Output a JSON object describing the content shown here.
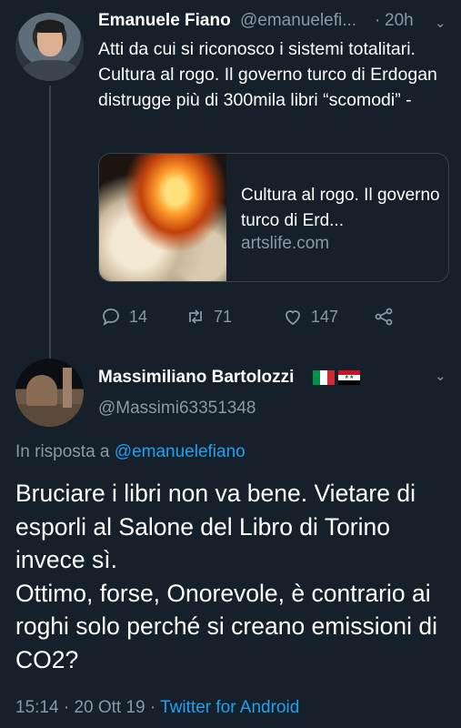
{
  "tweet1": {
    "name": "Emanuele Fiano",
    "handle": "@emanuelefi...",
    "dot": "·",
    "time": "20h",
    "text": "Atti da cui si riconosco i sistemi totalitari. Cultura al rogo. Il governo turco di Erdogan distrugge più di 300mila libri “scomodi” -",
    "card": {
      "title": "Cultura al rogo. Il governo turco di Erd...",
      "domain": "artslife.com"
    },
    "actions": {
      "replies": "14",
      "retweets": "71",
      "likes": "147"
    }
  },
  "tweet2": {
    "name": "Massimiliano Bartolozzi",
    "handle": "@Massimi63351348",
    "reply_prefix": "In risposta a",
    "reply_handle": "@emanuelefiano",
    "text_line1": "Bruciare i libri non va bene. Vietare di esporli al Salone del Libro di Torino invece sì.",
    "text_line2": "Ottimo, forse, Onorevole, è contrario ai roghi solo perché si creano emissioni di CO2?",
    "meta_time": "15:14",
    "meta_sep": "·",
    "meta_date": "20 Ott 19",
    "meta_client": "Twitter for Android"
  },
  "icons": [
    "reply-icon",
    "retweet-icon",
    "like-icon",
    "share-icon",
    "chevron-down-icon"
  ],
  "colors": {
    "background": "#15202b",
    "text": "#ffffff",
    "muted": "#8899a6",
    "link": "#1da1f2",
    "divider": "#38444d"
  }
}
